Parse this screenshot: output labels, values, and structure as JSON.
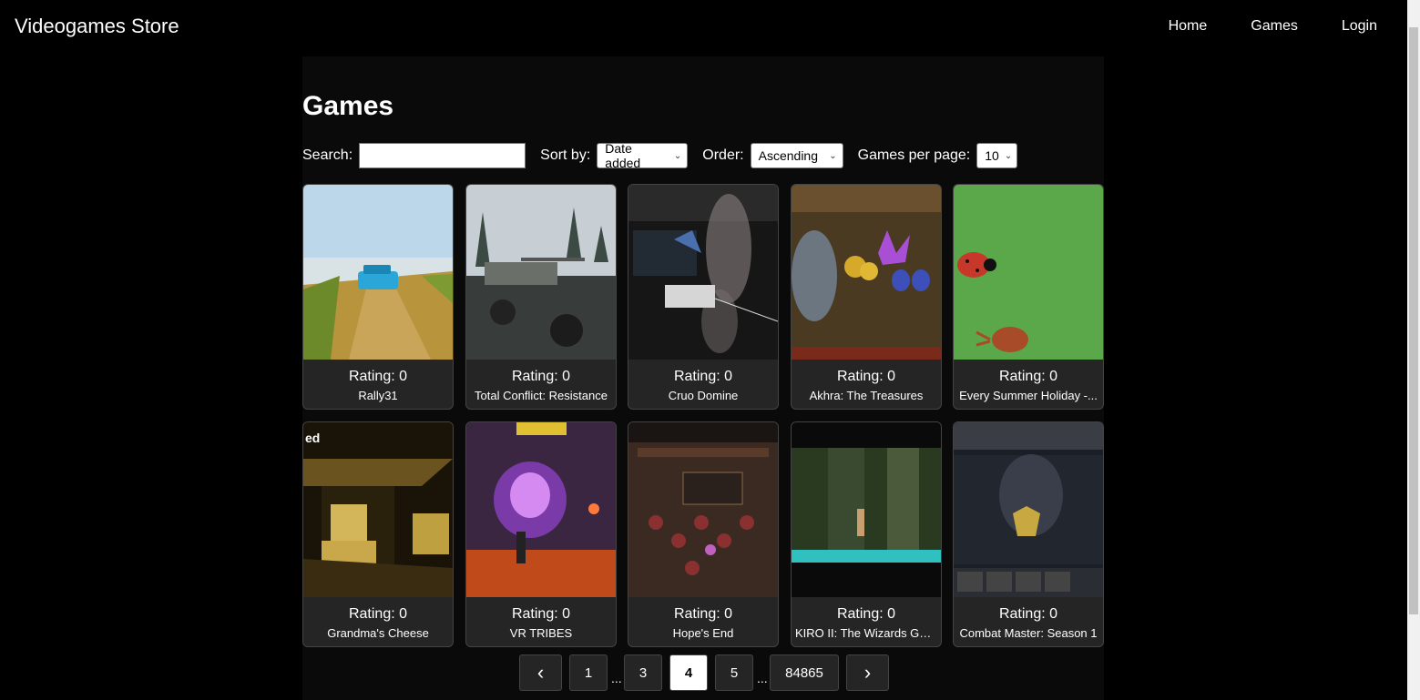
{
  "nav": {
    "brand": "Videogames Store",
    "links": [
      "Home",
      "Games",
      "Login"
    ]
  },
  "page": {
    "title": "Games"
  },
  "filters": {
    "search_label": "Search:",
    "search_value": "",
    "sort_label": "Sort by:",
    "sort_value": "Date added",
    "order_label": "Order:",
    "order_value": "Ascending",
    "per_page_label": "Games per page:",
    "per_page_value": "10"
  },
  "games": [
    {
      "rating": "Rating: 0",
      "name": "Rally31"
    },
    {
      "rating": "Rating: 0",
      "name": "Total Conflict: Resistance"
    },
    {
      "rating": "Rating: 0",
      "name": "Cruo Domine"
    },
    {
      "rating": "Rating: 0",
      "name": "Akhra: The Treasures"
    },
    {
      "rating": "Rating: 0",
      "name": "Every Summer Holiday -..."
    },
    {
      "rating": "Rating: 0",
      "name": "Grandma's Cheese"
    },
    {
      "rating": "Rating: 0",
      "name": "VR TRIBES"
    },
    {
      "rating": "Rating: 0",
      "name": "Hope's End"
    },
    {
      "rating": "Rating: 0",
      "name": "KIRO II: The Wizards Guild"
    },
    {
      "rating": "Rating: 0",
      "name": "Combat Master: Season 1"
    }
  ],
  "pagination": {
    "prev": "‹",
    "next": "›",
    "pages": [
      "1",
      "3",
      "4",
      "5",
      "84865"
    ],
    "current": "4",
    "ellipsis": "..."
  },
  "colors": {
    "background": "#000000",
    "card": "#252525",
    "card_border": "#444444",
    "active_page": "#ffffff"
  }
}
